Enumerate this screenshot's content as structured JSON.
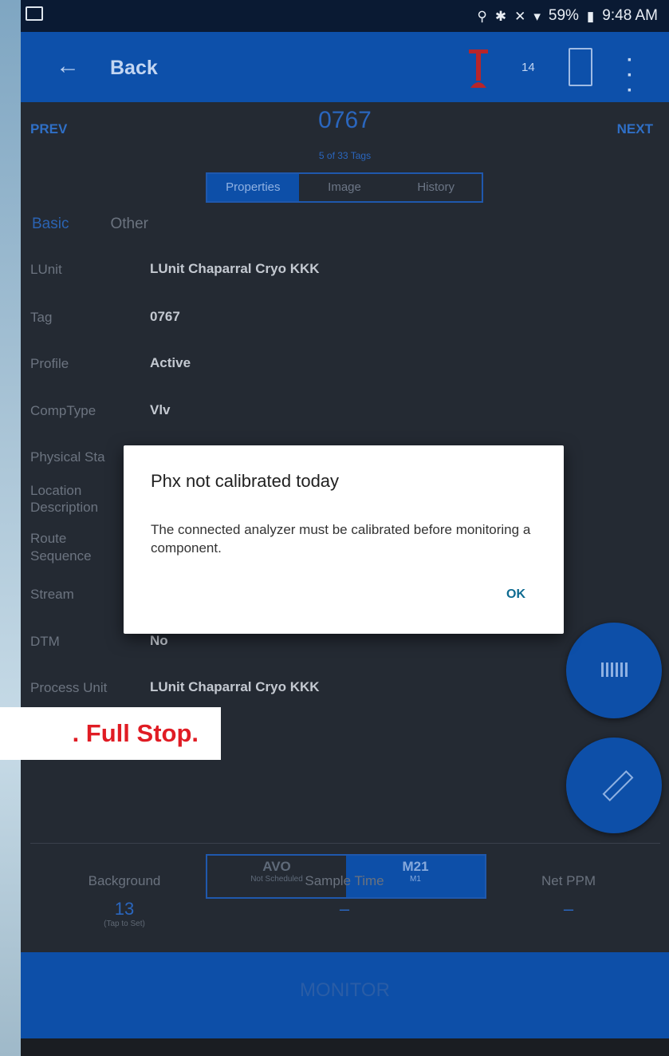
{
  "status_bar": {
    "battery": "59%",
    "time": "9:48 AM",
    "icons": [
      "gallery-icon",
      "location-icon",
      "bluetooth-icon",
      "mute-icon",
      "wifi-icon",
      "battery-icon"
    ]
  },
  "app_bar": {
    "back_label": "Back",
    "count": "14",
    "icons": [
      "back-arrow-icon",
      "probe-icon",
      "logbook-icon",
      "more-vert-icon"
    ]
  },
  "header": {
    "prev": "PREV",
    "next": "NEXT",
    "tag_number": "0767",
    "position": "5 of 33 Tags"
  },
  "tabs": [
    {
      "label": "Properties",
      "active": true
    },
    {
      "label": "Image",
      "active": false
    },
    {
      "label": "History",
      "active": false
    }
  ],
  "subtabs": {
    "basic": "Basic",
    "other": "Other"
  },
  "fields": {
    "lunit": {
      "label": "LUnit",
      "value": "LUnit Chaparral Cryo KKK"
    },
    "tag": {
      "label": "Tag",
      "value": "0767"
    },
    "profile": {
      "label": "Profile",
      "value": "Active"
    },
    "comptype": {
      "label": "CompType",
      "value": "Vlv"
    },
    "physical_status": {
      "label": "Physical Sta"
    },
    "location": {
      "label_1": "Location",
      "label_2": "Description"
    },
    "route": {
      "label_1": "Route",
      "label_2": "Sequence"
    },
    "stream": {
      "label": "Stream"
    },
    "dtm": {
      "label": "DTM",
      "value": "No"
    },
    "process_unit": {
      "label": "Process Unit",
      "value": "LUnit Chaparral Cryo KKK"
    }
  },
  "method_toggle": {
    "avo": {
      "title": "AVO",
      "sub": "Not Scheduled"
    },
    "m21": {
      "title": "M21",
      "sub": "M1"
    }
  },
  "stats": {
    "background": {
      "label": "Background",
      "value": "13",
      "hint": "(Tap to Set)"
    },
    "sample_time": {
      "label": "Sample Time",
      "value": "–"
    },
    "net_ppm": {
      "label": "Net PPM",
      "value": "–"
    }
  },
  "monitor_button": "MONITOR",
  "banner": {
    "text": ". Full Stop."
  },
  "dialog": {
    "title": "Phx not calibrated today",
    "message": "The connected analyzer must be calibrated before monitoring a component.",
    "ok": "OK"
  },
  "colors": {
    "primary": "#0d50aa",
    "dialog_ok": "#0e6b91",
    "banner_text": "#e01c24"
  }
}
